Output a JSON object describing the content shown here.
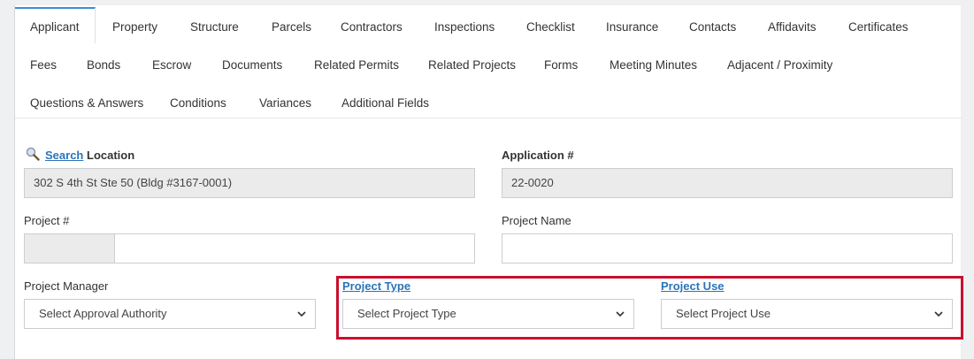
{
  "tabs_row1": [
    "Applicant",
    "Property",
    "Structure",
    "Parcels",
    "Contractors",
    "Inspections",
    "Checklist",
    "Insurance",
    "Contacts",
    "Affidavits",
    "Certificates"
  ],
  "tabs_row2": [
    "Fees",
    "Bonds",
    "Escrow",
    "Documents",
    "Related Permits",
    "Related Projects",
    "Forms",
    "Meeting Minutes",
    "Adjacent / Proximity"
  ],
  "tabs_row3": [
    "Questions & Answers",
    "Conditions",
    "Variances",
    "Additional Fields"
  ],
  "active_tab": "Applicant",
  "location": {
    "search_link": "Search",
    "label": "Location",
    "value": "302 S 4th St Ste 50 (Bldg #3167-0001)"
  },
  "application": {
    "label": "Application #",
    "value": "22-0020"
  },
  "project_number": {
    "label": "Project #",
    "prefix_value": "",
    "value": ""
  },
  "project_name": {
    "label": "Project Name",
    "value": ""
  },
  "project_manager": {
    "label": "Project Manager",
    "selected": "Select Approval Authority"
  },
  "project_type": {
    "label": "Project Type",
    "selected": "Select Project Type"
  },
  "project_use": {
    "label": "Project Use",
    "selected": "Select Project Use"
  },
  "colors": {
    "accent": "#3a8ed6",
    "link": "#2a74b8",
    "highlight": "#c8102e"
  }
}
